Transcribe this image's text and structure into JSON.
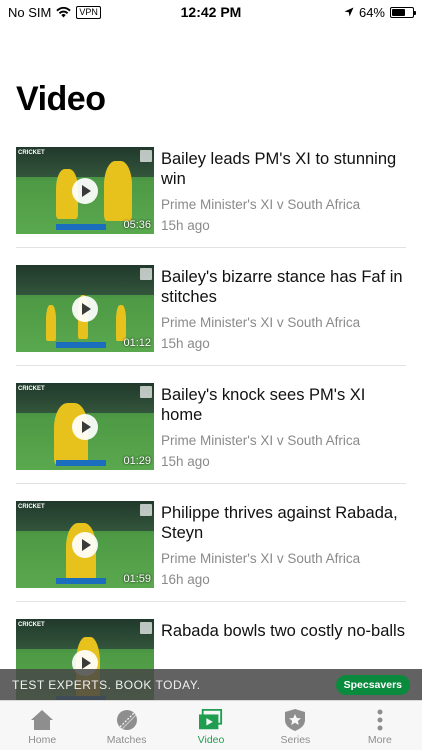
{
  "status_bar": {
    "carrier": "No SIM",
    "vpn": "VPN",
    "time": "12:42 PM",
    "battery": "64%",
    "battery_level": 0.64
  },
  "page": {
    "title": "Video"
  },
  "videos": [
    {
      "title": "Bailey leads PM's XI to stunning win",
      "series": "Prime Minister's XI v South Africa",
      "age": "15h ago",
      "duration": "05:36",
      "logo": "CRICKET"
    },
    {
      "title": "Bailey's bizarre stance has Faf in stitches",
      "series": "Prime Minister's XI v South Africa",
      "age": "15h ago",
      "duration": "01:12",
      "logo": ""
    },
    {
      "title": "Bailey's knock sees PM's XI home",
      "series": "Prime Minister's XI v South Africa",
      "age": "15h ago",
      "duration": "01:29",
      "logo": "CRICKET"
    },
    {
      "title": "Philippe thrives against Rabada, Steyn",
      "series": "Prime Minister's XI v South Africa",
      "age": "16h ago",
      "duration": "01:59",
      "logo": "CRICKET"
    },
    {
      "title": "Rabada bowls two costly no-balls",
      "series": "",
      "age": "",
      "duration": "",
      "logo": "CRICKET"
    }
  ],
  "ad": {
    "text": "TEST EXPERTS. BOOK TODAY.",
    "brand": "Specsavers",
    "brand_color": "#0a8a3c"
  },
  "tabs": [
    {
      "label": "Home",
      "icon": "home-icon"
    },
    {
      "label": "Matches",
      "icon": "cricket-ball-icon"
    },
    {
      "label": "Video",
      "icon": "video-icon",
      "active": true
    },
    {
      "label": "Series",
      "icon": "shield-star-icon"
    },
    {
      "label": "More",
      "icon": "more-dots-icon"
    }
  ],
  "colors": {
    "accent": "#1e9e4e",
    "inactive": "#8e8e8e"
  }
}
